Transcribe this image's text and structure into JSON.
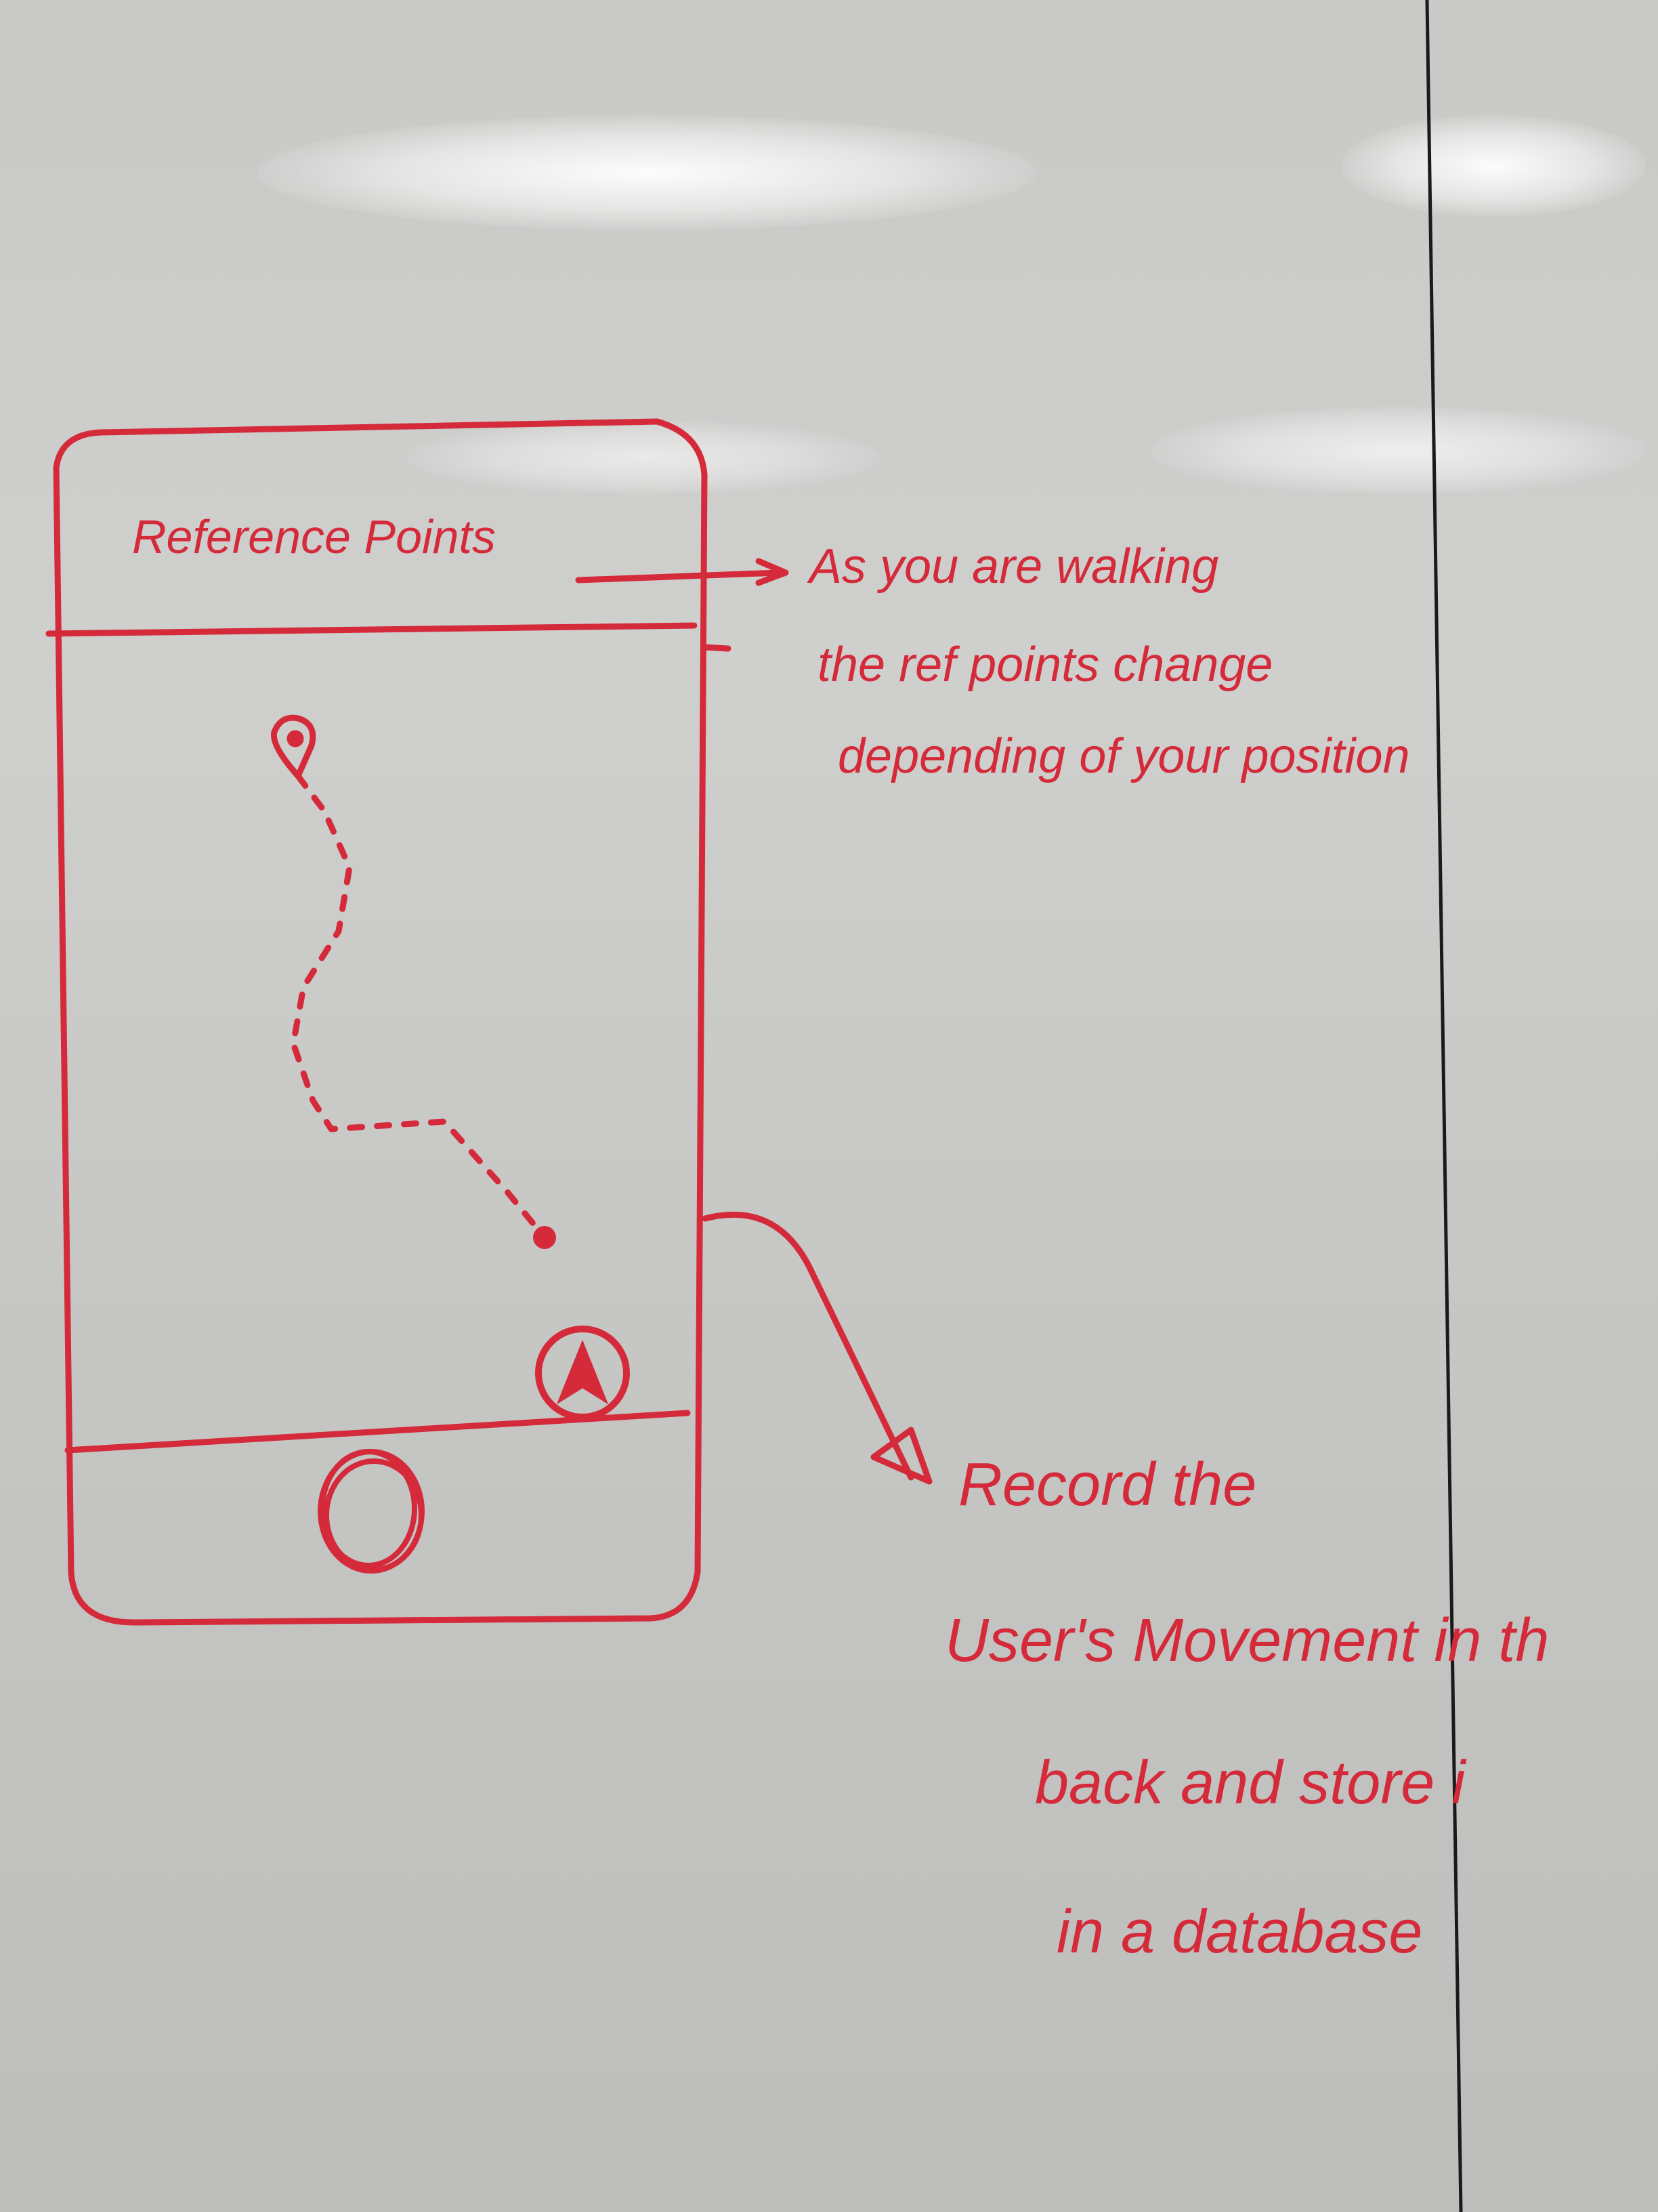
{
  "sketch": {
    "screen_title": "Reference Points",
    "colors": {
      "marker": "#d42a3a",
      "board": "#cbccca",
      "divider": "#1a1a1a"
    },
    "icons": [
      "location-pin-icon",
      "current-position-dot-icon",
      "navigation-arrow-icon",
      "record-button-icon"
    ]
  },
  "annotations": {
    "reference_points": {
      "lines": [
        "As you are walking",
        "the ref points change",
        "depending of your position"
      ]
    },
    "recording": {
      "lines": [
        "Record the",
        "User's Movement in th",
        "back and store i",
        "in a database"
      ]
    }
  }
}
